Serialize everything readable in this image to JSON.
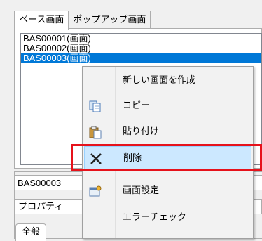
{
  "tabs": [
    {
      "label": "ベース画面",
      "active": true
    },
    {
      "label": "ポップアップ画面",
      "active": false
    }
  ],
  "list": {
    "items": [
      {
        "label": "BAS00001(画面)",
        "selected": false
      },
      {
        "label": "BAS00002(画面)",
        "selected": false
      },
      {
        "label": "BAS00003(画面)",
        "selected": true
      }
    ]
  },
  "bottom_panel": {
    "object_name": "BAS00003",
    "property_label": "プロパティ",
    "subtab_label": "全般"
  },
  "context_menu": {
    "items": [
      {
        "label": "新しい画面を作成",
        "icon": "none"
      },
      {
        "label": "コピー",
        "icon": "copy-icon"
      },
      {
        "label": "貼り付け",
        "icon": "paste-icon"
      },
      {
        "label": "削除",
        "icon": "delete-icon",
        "hovered": true
      },
      {
        "label": "画面設定",
        "icon": "settings-icon"
      },
      {
        "label": "エラーチェック",
        "icon": "none"
      }
    ]
  },
  "colors": {
    "selection": "#0078d7",
    "hover": "#cce8ff",
    "highlight_box": "#e6121b"
  }
}
